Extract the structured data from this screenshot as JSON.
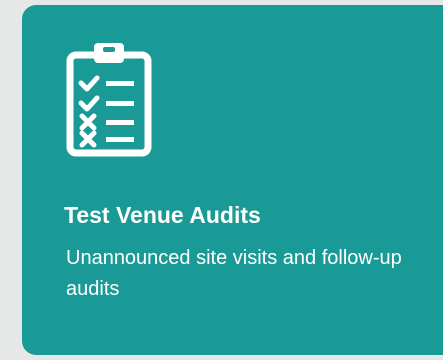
{
  "card": {
    "icon": "clipboard-checklist-icon",
    "title": "Test Venue Audits",
    "description": "Unannounced site visits and follow-up audits",
    "background_color": "#1a9a96",
    "text_color": "#ffffff"
  }
}
